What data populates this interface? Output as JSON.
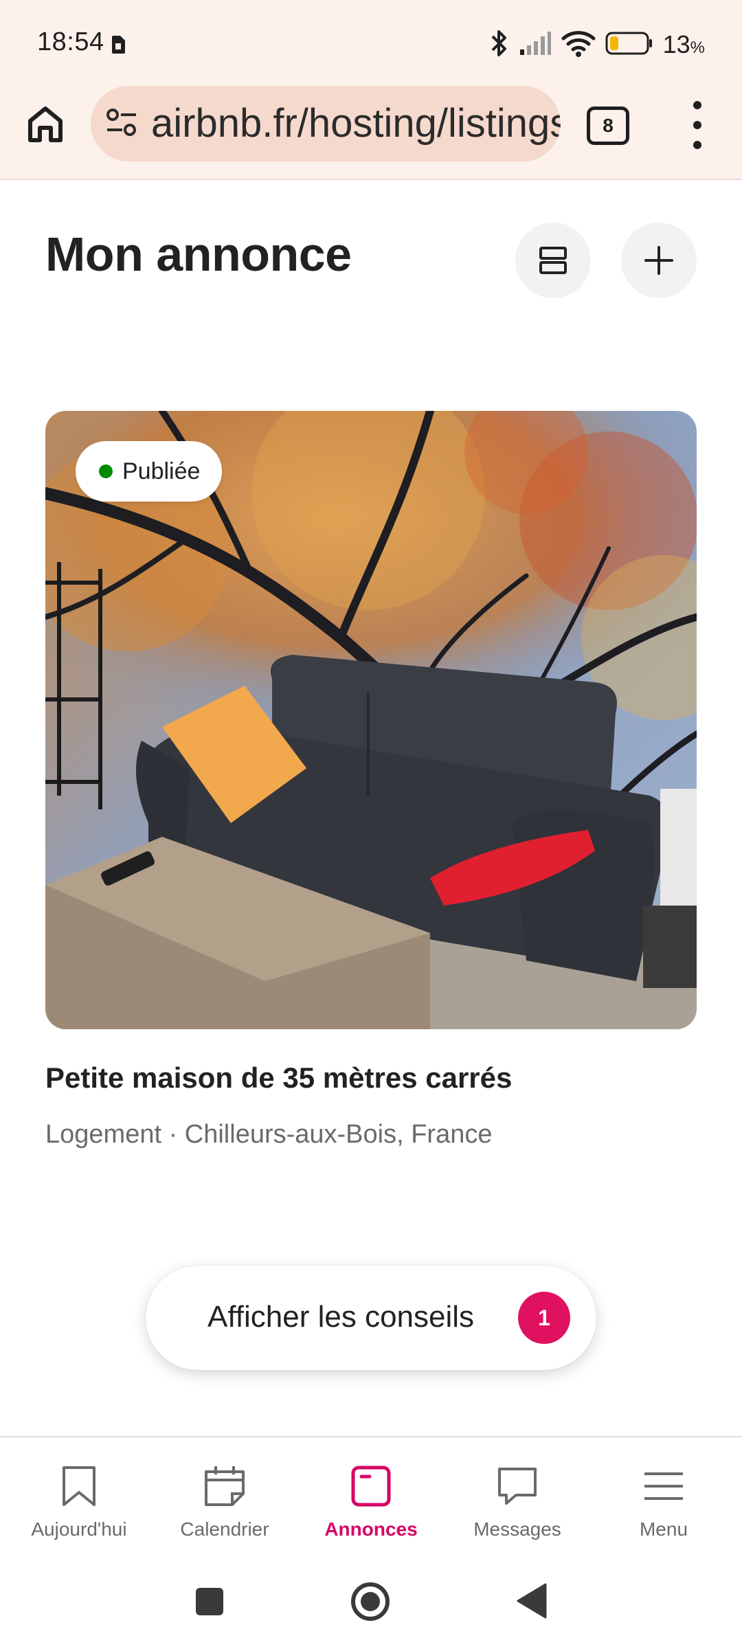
{
  "status_bar": {
    "time": "18:54",
    "battery_percent": "13",
    "battery_unit": "%"
  },
  "browser": {
    "url": "airbnb.fr/hosting/listings",
    "tab_count": "8"
  },
  "header": {
    "title": "Mon annonce"
  },
  "listing": {
    "status": "Publiée",
    "title": "Petite maison de 35 mètres carrés",
    "subtitle": "Logement · Chilleurs-aux-Bois, France"
  },
  "tips": {
    "label": "Afficher les conseils",
    "count": "1"
  },
  "nav": {
    "items": [
      {
        "label": "Aujourd'hui",
        "icon": "bookmark-icon"
      },
      {
        "label": "Calendrier",
        "icon": "calendar-icon"
      },
      {
        "label": "Annonces",
        "icon": "listings-icon"
      },
      {
        "label": "Messages",
        "icon": "message-icon"
      },
      {
        "label": "Menu",
        "icon": "menu-icon"
      }
    ],
    "active": "Annonces"
  },
  "colors": {
    "accent": "#d70466",
    "badge": "#e0115f",
    "published_dot": "#008a05",
    "browser_bar": "#fdf1ec"
  }
}
